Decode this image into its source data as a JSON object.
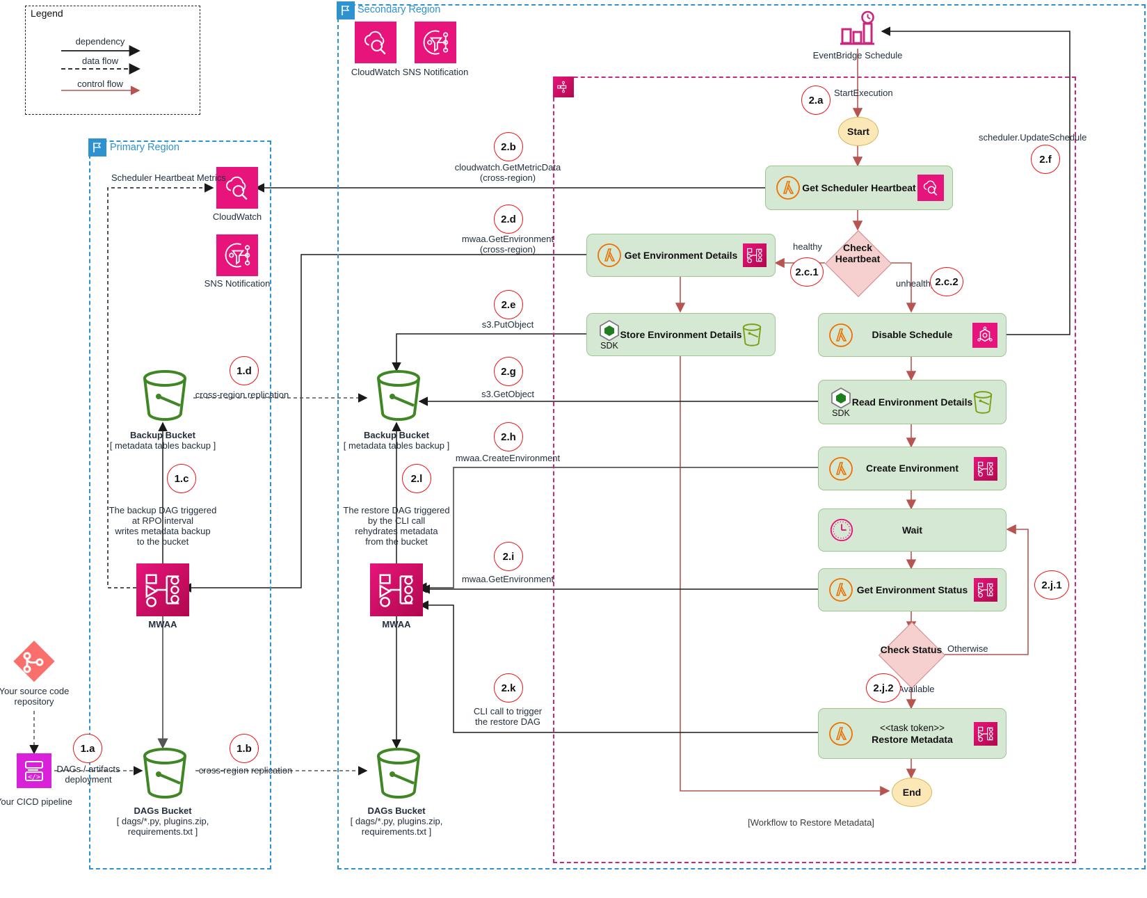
{
  "legend": {
    "title": "Legend",
    "items": [
      {
        "label": "dependency",
        "style": "solid-black"
      },
      {
        "label": "data flow",
        "style": "dashed-black"
      },
      {
        "label": "control flow",
        "style": "solid-red"
      }
    ]
  },
  "regions": {
    "secondary": {
      "title": "Secondary Region",
      "icon": "region-flag-icon"
    },
    "primary": {
      "title": "Primary Region",
      "icon": "region-flag-icon"
    }
  },
  "workflow_region": {
    "caption": "[Workflow to Restore Metadata]",
    "icon": "step-functions-icon"
  },
  "secondary_services": [
    {
      "name": "CloudWatch",
      "icon": "cloudwatch-icon"
    },
    {
      "name": "SNS Notification",
      "icon": "sns-icon"
    }
  ],
  "primary_services": [
    {
      "name": "CloudWatch",
      "icon": "cloudwatch-icon"
    },
    {
      "name": "SNS Notification",
      "icon": "sns-icon"
    }
  ],
  "eventbridge": {
    "label": "EventBridge Schedule",
    "icon": "eventbridge-schedule-icon"
  },
  "external": {
    "source_repo": {
      "label": "Your source code\nrepository",
      "icon": "git-repo-icon"
    },
    "cicd": {
      "label": "Your CICD pipeline",
      "icon": "cicd-pipeline-icon"
    }
  },
  "buckets": {
    "primary_backup": {
      "title": "Backup Bucket",
      "subtitle": "[ metadata tables backup ]",
      "icon": "s3-bucket-icon"
    },
    "secondary_backup": {
      "title": "Backup Bucket",
      "subtitle": "[ metadata tables backup ]",
      "icon": "s3-bucket-icon"
    },
    "primary_dags": {
      "title": "DAGs Bucket",
      "subtitle": "[ dags/*.py, plugins.zip,\nrequirements.txt ]",
      "icon": "s3-bucket-icon"
    },
    "secondary_dags": {
      "title": "DAGs Bucket",
      "subtitle": "[ dags/*.py, plugins.zip,\nrequirements.txt ]",
      "icon": "s3-bucket-icon"
    }
  },
  "mwaa": {
    "primary": {
      "label": "MWAA",
      "icon": "mwaa-icon"
    },
    "secondary": {
      "label": "MWAA",
      "icon": "mwaa-icon"
    }
  },
  "states": [
    {
      "id": "start",
      "label": "Start",
      "shape": "terminal"
    },
    {
      "id": "get_scheduler_heartbeat",
      "label": "Get Scheduler Heartbeat",
      "left_icon": "lambda-icon",
      "right_icon": "cloudwatch-icon"
    },
    {
      "id": "check_heartbeat",
      "label": "Check\nHeartbeat",
      "shape": "choice"
    },
    {
      "id": "get_environment_details",
      "label": "Get Environment Details",
      "left_icon": "lambda-icon",
      "right_icon": "mwaa-icon"
    },
    {
      "id": "store_environment_details",
      "label": "Store Environment Details",
      "left_icon": "sdk-icon",
      "left_icon_label": "SDK",
      "right_icon": "s3-bucket-icon"
    },
    {
      "id": "disable_schedule",
      "label": "Disable Schedule",
      "left_icon": "lambda-icon",
      "right_icon": "eventbridge-scheduler-icon"
    },
    {
      "id": "read_environment_details",
      "label": "Read Environment Details",
      "left_icon": "sdk-icon",
      "left_icon_label": "SDK",
      "right_icon": "s3-bucket-icon"
    },
    {
      "id": "create_environment",
      "label": "Create Environment",
      "left_icon": "lambda-icon",
      "right_icon": "mwaa-icon"
    },
    {
      "id": "wait",
      "label": "Wait",
      "left_icon": "clock-icon"
    },
    {
      "id": "get_environment_status",
      "label": "Get Environment Status",
      "left_icon": "lambda-icon",
      "right_icon": "mwaa-icon"
    },
    {
      "id": "check_status",
      "label": "Check\nStatus",
      "shape": "choice"
    },
    {
      "id": "restore_metadata",
      "label": "Restore Metadata",
      "token": "<<task token>>",
      "left_icon": "lambda-icon",
      "right_icon": "mwaa-icon"
    },
    {
      "id": "end",
      "label": "End",
      "shape": "terminal"
    }
  ],
  "edge_labels": {
    "start_execution": "StartExecution",
    "healthy": "healthy",
    "unhealthy": "unhealthy",
    "otherwise": "Otherwise",
    "available": "Available",
    "scheduler_update": "scheduler.UpdateSchedule",
    "scheduler_heartbeat_metrics": "Scheduler Heartbeat Metrics",
    "cross_region_replication_backup": "cross-region replication",
    "cross_region_replication_dags": "cross-region replication",
    "dags_artifacts_deployment": "DAGs / artifacts\ndeployment",
    "backup_dag_note": "The backup DAG triggered\nat RPO interval\nwrites metadata backup\nto the bucket",
    "restore_dag_note": "The restore DAG triggered\nby the CLI call\nrehydrates metadata\nfrom the bucket",
    "get_metric_data": "cloudwatch.GetMetricData\n(cross-region)",
    "mwaa_get_environment_cross": "mwaa.GetEnvironment\n(cross-region)",
    "s3_put_object": "s3.PutObject",
    "s3_get_object": "s3.GetObject",
    "mwaa_create_environment": "mwaa.CreateEnvironment",
    "mwaa_get_environment": "mwaa.GetEnvironment",
    "cli_call_restore": "CLI call to trigger\nthe restore DAG"
  },
  "step_markers": [
    {
      "id": "1a",
      "label": "1.a"
    },
    {
      "id": "1b",
      "label": "1.b"
    },
    {
      "id": "1c",
      "label": "1.c"
    },
    {
      "id": "1d",
      "label": "1.d"
    },
    {
      "id": "2a",
      "label": "2.a"
    },
    {
      "id": "2b",
      "label": "2.b"
    },
    {
      "id": "2c1",
      "label": "2.c.1"
    },
    {
      "id": "2c2",
      "label": "2.c.2"
    },
    {
      "id": "2d",
      "label": "2.d"
    },
    {
      "id": "2e",
      "label": "2.e"
    },
    {
      "id": "2f",
      "label": "2.f"
    },
    {
      "id": "2g",
      "label": "2.g"
    },
    {
      "id": "2h",
      "label": "2.h"
    },
    {
      "id": "2i",
      "label": "2.i"
    },
    {
      "id": "2j1",
      "label": "2.j.1"
    },
    {
      "id": "2j2",
      "label": "2.j.2"
    },
    {
      "id": "2k",
      "label": "2.k"
    },
    {
      "id": "2l",
      "label": "2.l"
    }
  ],
  "colors": {
    "aws_pink": "#e7157b",
    "aws_orange": "#ed7100",
    "s3_green": "#3f8624",
    "region_blue": "#2e92d1",
    "sfn_pink": "#c9267d",
    "state_green": "#d5e8d4",
    "choice_red": "#f6cfcf",
    "terminal_yellow": "#fbe8b6",
    "marker_red": "#ee1111",
    "control_flow": "#b85450"
  }
}
